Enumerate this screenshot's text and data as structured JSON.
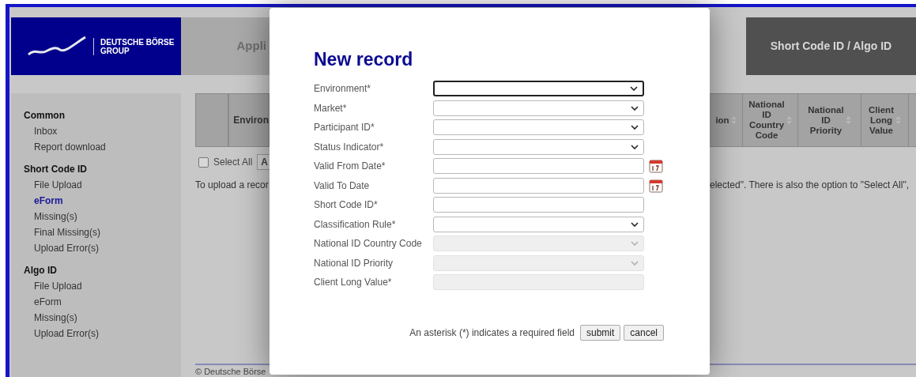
{
  "logo": {
    "line1": "DEUTSCHE BÖRSE",
    "line2": "GROUP"
  },
  "header": {
    "title_left": "Appli",
    "title_right": "Short Code ID / Algo ID"
  },
  "sidebar": {
    "sections": [
      {
        "title": "Common",
        "items": [
          {
            "label": "Inbox",
            "selected": false
          },
          {
            "label": "Report download",
            "selected": false
          }
        ]
      },
      {
        "title": "Short Code ID",
        "items": [
          {
            "label": "File Upload",
            "selected": false
          },
          {
            "label": "eForm",
            "selected": true
          },
          {
            "label": "Missing(s)",
            "selected": false
          },
          {
            "label": "Final Missing(s)",
            "selected": false
          },
          {
            "label": "Upload Error(s)",
            "selected": false
          }
        ]
      },
      {
        "title": "Algo ID",
        "items": [
          {
            "label": "File Upload",
            "selected": false
          },
          {
            "label": "eForm",
            "selected": false
          },
          {
            "label": "Missing(s)",
            "selected": false
          },
          {
            "label": "Upload Error(s)",
            "selected": false
          }
        ]
      }
    ]
  },
  "table": {
    "columns_left": [
      {
        "label": "Environ"
      }
    ],
    "columns_right": [
      {
        "label": "ion"
      },
      {
        "label": "National ID Country Code"
      },
      {
        "label": "National ID Priority"
      },
      {
        "label": "Client Long Value"
      }
    ]
  },
  "select_all": {
    "label": "Select All",
    "checked": false
  },
  "action_button": "A",
  "intro_text_left": "To upload a recor",
  "intro_text_right": "elected\". There is also the option to \"Select All\",",
  "footer": "© Deutsche Börse",
  "modal": {
    "title": "New record",
    "fields": [
      {
        "label": "Environment*",
        "kind": "select",
        "disabled": false,
        "focused": true
      },
      {
        "label": "Market*",
        "kind": "select",
        "disabled": false,
        "focused": false
      },
      {
        "label": "Participant ID*",
        "kind": "select",
        "disabled": false,
        "focused": false
      },
      {
        "label": "Status Indicator*",
        "kind": "select",
        "disabled": false,
        "focused": false
      },
      {
        "label": "Valid From Date*",
        "kind": "date",
        "disabled": false,
        "focused": false
      },
      {
        "label": "Valid To Date",
        "kind": "date",
        "disabled": false,
        "focused": false
      },
      {
        "label": "Short Code ID*",
        "kind": "text",
        "disabled": false,
        "focused": false
      },
      {
        "label": "Classification Rule*",
        "kind": "select",
        "disabled": false,
        "focused": false
      },
      {
        "label": "National ID Country Code",
        "kind": "select",
        "disabled": true,
        "focused": false
      },
      {
        "label": "National ID Priority",
        "kind": "select",
        "disabled": true,
        "focused": false
      },
      {
        "label": "Client Long Value*",
        "kind": "text",
        "disabled": true,
        "focused": false
      }
    ],
    "note": "An asterisk (*) indicates a required field",
    "buttons": [
      "submit",
      "cancel"
    ]
  }
}
